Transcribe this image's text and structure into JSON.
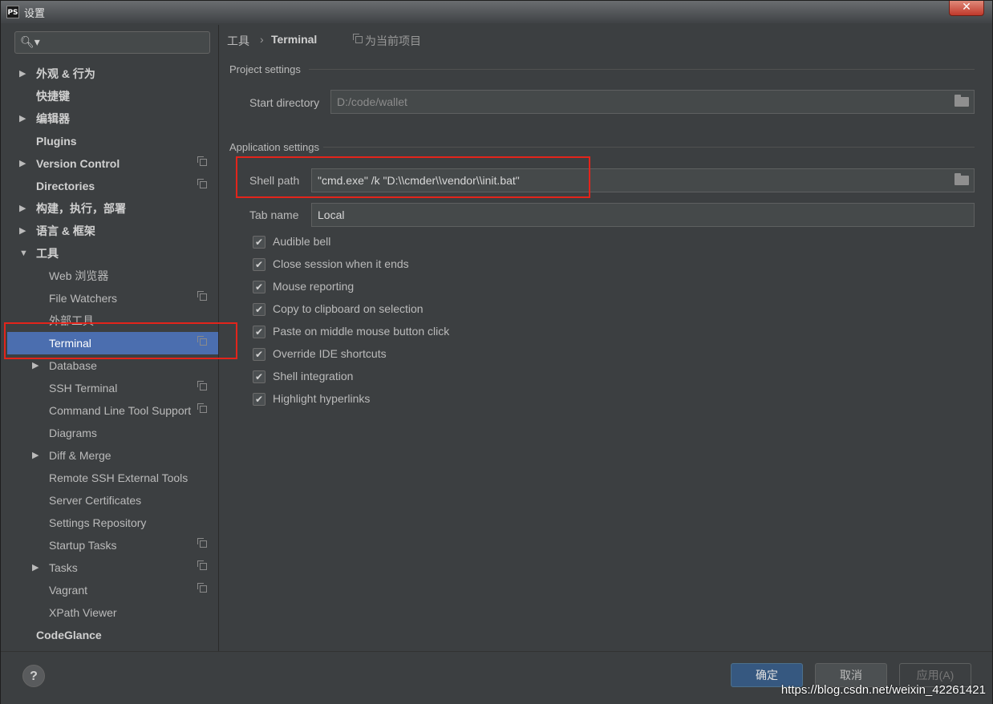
{
  "window": {
    "title": "设置",
    "app_icon": "PS"
  },
  "search": {
    "value": ""
  },
  "sidebar": {
    "items": [
      {
        "label": "外观 & 行为",
        "arrow": "▶",
        "bold": true,
        "proj": false
      },
      {
        "label": "快捷键",
        "arrow": "",
        "bold": true,
        "proj": false
      },
      {
        "label": "编辑器",
        "arrow": "▶",
        "bold": true,
        "proj": false
      },
      {
        "label": "Plugins",
        "arrow": "",
        "bold": true,
        "proj": false
      },
      {
        "label": "Version Control",
        "arrow": "▶",
        "bold": true,
        "proj": true
      },
      {
        "label": "Directories",
        "arrow": "",
        "bold": true,
        "proj": true
      },
      {
        "label": "构建，执行，部署",
        "arrow": "▶",
        "bold": true,
        "proj": false
      },
      {
        "label": "语言 & 框架",
        "arrow": "▶",
        "bold": true,
        "proj": false
      },
      {
        "label": "工具",
        "arrow": "▼",
        "bold": true,
        "proj": false
      },
      {
        "label": "Web 浏览器",
        "arrow": "",
        "bold": false,
        "proj": false,
        "child": true
      },
      {
        "label": "File Watchers",
        "arrow": "",
        "bold": false,
        "proj": true,
        "child": true
      },
      {
        "label": "外部工具",
        "arrow": "",
        "bold": false,
        "proj": false,
        "child": true
      },
      {
        "label": "Terminal",
        "arrow": "",
        "bold": false,
        "proj": true,
        "child": true,
        "selected": true
      },
      {
        "label": "Database",
        "arrow": "▶",
        "bold": false,
        "proj": false,
        "child": true
      },
      {
        "label": "SSH Terminal",
        "arrow": "",
        "bold": false,
        "proj": true,
        "child": true
      },
      {
        "label": "Command Line Tool Support",
        "arrow": "",
        "bold": false,
        "proj": true,
        "child": true
      },
      {
        "label": "Diagrams",
        "arrow": "",
        "bold": false,
        "proj": false,
        "child": true
      },
      {
        "label": "Diff & Merge",
        "arrow": "▶",
        "bold": false,
        "proj": false,
        "child": true
      },
      {
        "label": "Remote SSH External Tools",
        "arrow": "",
        "bold": false,
        "proj": false,
        "child": true
      },
      {
        "label": "Server Certificates",
        "arrow": "",
        "bold": false,
        "proj": false,
        "child": true
      },
      {
        "label": "Settings Repository",
        "arrow": "",
        "bold": false,
        "proj": false,
        "child": true
      },
      {
        "label": "Startup Tasks",
        "arrow": "",
        "bold": false,
        "proj": true,
        "child": true
      },
      {
        "label": "Tasks",
        "arrow": "▶",
        "bold": false,
        "proj": true,
        "child": true
      },
      {
        "label": "Vagrant",
        "arrow": "",
        "bold": false,
        "proj": true,
        "child": true
      },
      {
        "label": "XPath Viewer",
        "arrow": "",
        "bold": false,
        "proj": false,
        "child": true
      },
      {
        "label": "CodeGlance",
        "arrow": "",
        "bold": true,
        "proj": false
      }
    ]
  },
  "breadcrumb": {
    "parent": "工具",
    "separator": "›",
    "current": "Terminal",
    "scope": "为当前项目"
  },
  "project_settings": {
    "title": "Project settings",
    "start_directory_label": "Start directory",
    "start_directory_value": "D:/code/wallet"
  },
  "application_settings": {
    "title": "Application settings",
    "shell_path_label": "Shell path",
    "shell_path_value": "\"cmd.exe\" /k  \"D:\\\\cmder\\\\vendor\\\\init.bat\"",
    "tab_name_label": "Tab name",
    "tab_name_value": "Local",
    "checkboxes": [
      {
        "label": "Audible bell",
        "checked": true
      },
      {
        "label": "Close session when it ends",
        "checked": true
      },
      {
        "label": "Mouse reporting",
        "checked": true
      },
      {
        "label": "Copy to clipboard on selection",
        "checked": true
      },
      {
        "label": "Paste on middle mouse button click",
        "checked": true
      },
      {
        "label": "Override IDE shortcuts",
        "checked": true
      },
      {
        "label": "Shell integration",
        "checked": true
      },
      {
        "label": "Highlight hyperlinks",
        "checked": true
      }
    ]
  },
  "buttons": {
    "ok": "确定",
    "cancel": "取消",
    "apply": "应用(A)",
    "help": "?"
  },
  "watermark": "https://blog.csdn.net/weixin_42261421",
  "colors": {
    "selection": "#4b6eaf",
    "annotation_red": "#e3241b",
    "ok_button": "#365880"
  }
}
